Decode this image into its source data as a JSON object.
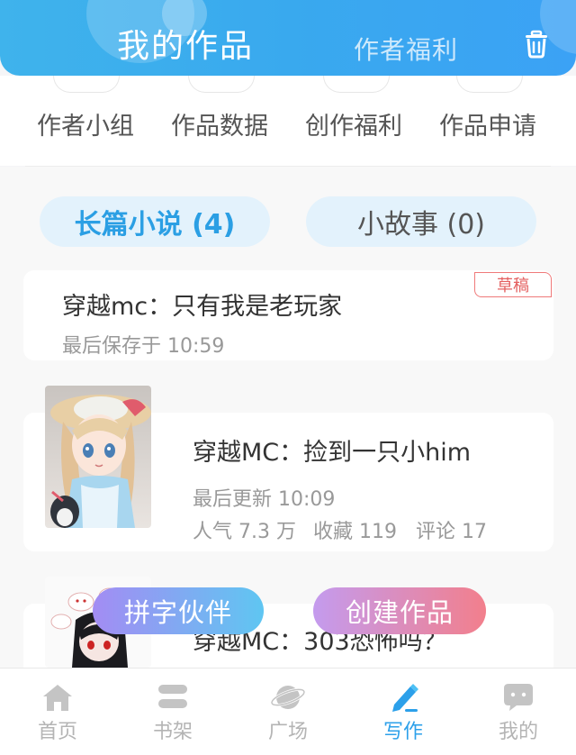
{
  "header": {
    "title": "我的作品",
    "welfare_tab": "作者福利",
    "trash_icon": "trash-icon",
    "accent": "#3aa8ee"
  },
  "quick_links": [
    {
      "label": "作者小组"
    },
    {
      "label": "作品数据"
    },
    {
      "label": "创作福利"
    },
    {
      "label": "作品申请"
    }
  ],
  "tabs": {
    "novel": "长篇小说 (4)",
    "story": "小故事 (0)"
  },
  "works": [
    {
      "badge": "草稿",
      "title": "穿越mc：只有我是老玩家",
      "saved": "最后保存于 10:59"
    },
    {
      "title": "穿越MC：捡到一只小him",
      "updated": "最后更新 10:09",
      "popularity": "人气 7.3 万",
      "favorites": "收藏 119",
      "comments": "评论 17"
    },
    {
      "title": "穿越MC：303恐怖吗？"
    }
  ],
  "actions": {
    "partner": "拼字伙伴",
    "create": "创建作品"
  },
  "nav": [
    {
      "label": "首页",
      "icon": "home-icon"
    },
    {
      "label": "书架",
      "icon": "bookshelf-icon"
    },
    {
      "label": "广场",
      "icon": "planet-icon"
    },
    {
      "label": "写作",
      "icon": "pen-icon"
    },
    {
      "label": "我的",
      "icon": "chat-bubble-icon"
    }
  ],
  "colors": {
    "active_tab": "#2ca0ea",
    "draft_badge": "#e46060"
  }
}
